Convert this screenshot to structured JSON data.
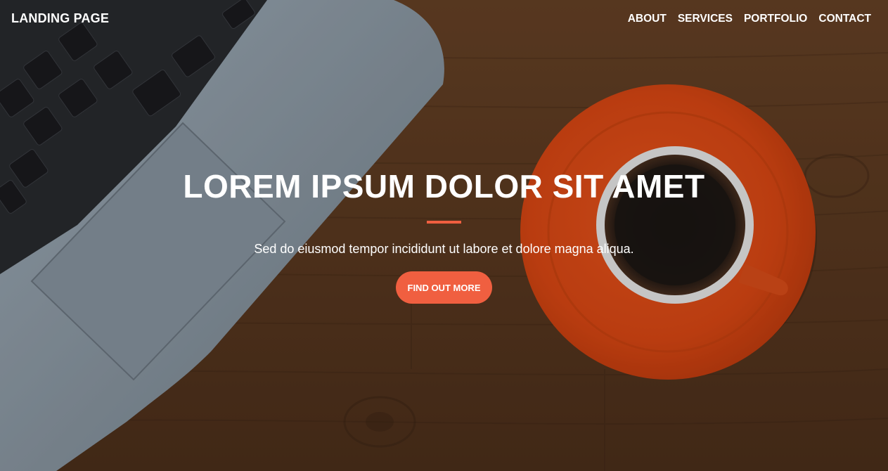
{
  "navbar": {
    "brand": "LANDING PAGE",
    "links": [
      {
        "label": "ABOUT"
      },
      {
        "label": "SERVICES"
      },
      {
        "label": "PORTFOLIO"
      },
      {
        "label": "CONTACT"
      }
    ]
  },
  "hero": {
    "headline": "LOREM IPSUM DOLOR SIT AMET",
    "subtext": "Sed do eiusmod tempor incididunt ut labore et dolore magna aliqua.",
    "cta_label": "FIND OUT MORE",
    "background_image": "laptop-and-coffee-cup-on-wooden-desk"
  },
  "colors": {
    "accent": "#f05f40",
    "text": "#ffffff",
    "wood": "#6b4528"
  }
}
